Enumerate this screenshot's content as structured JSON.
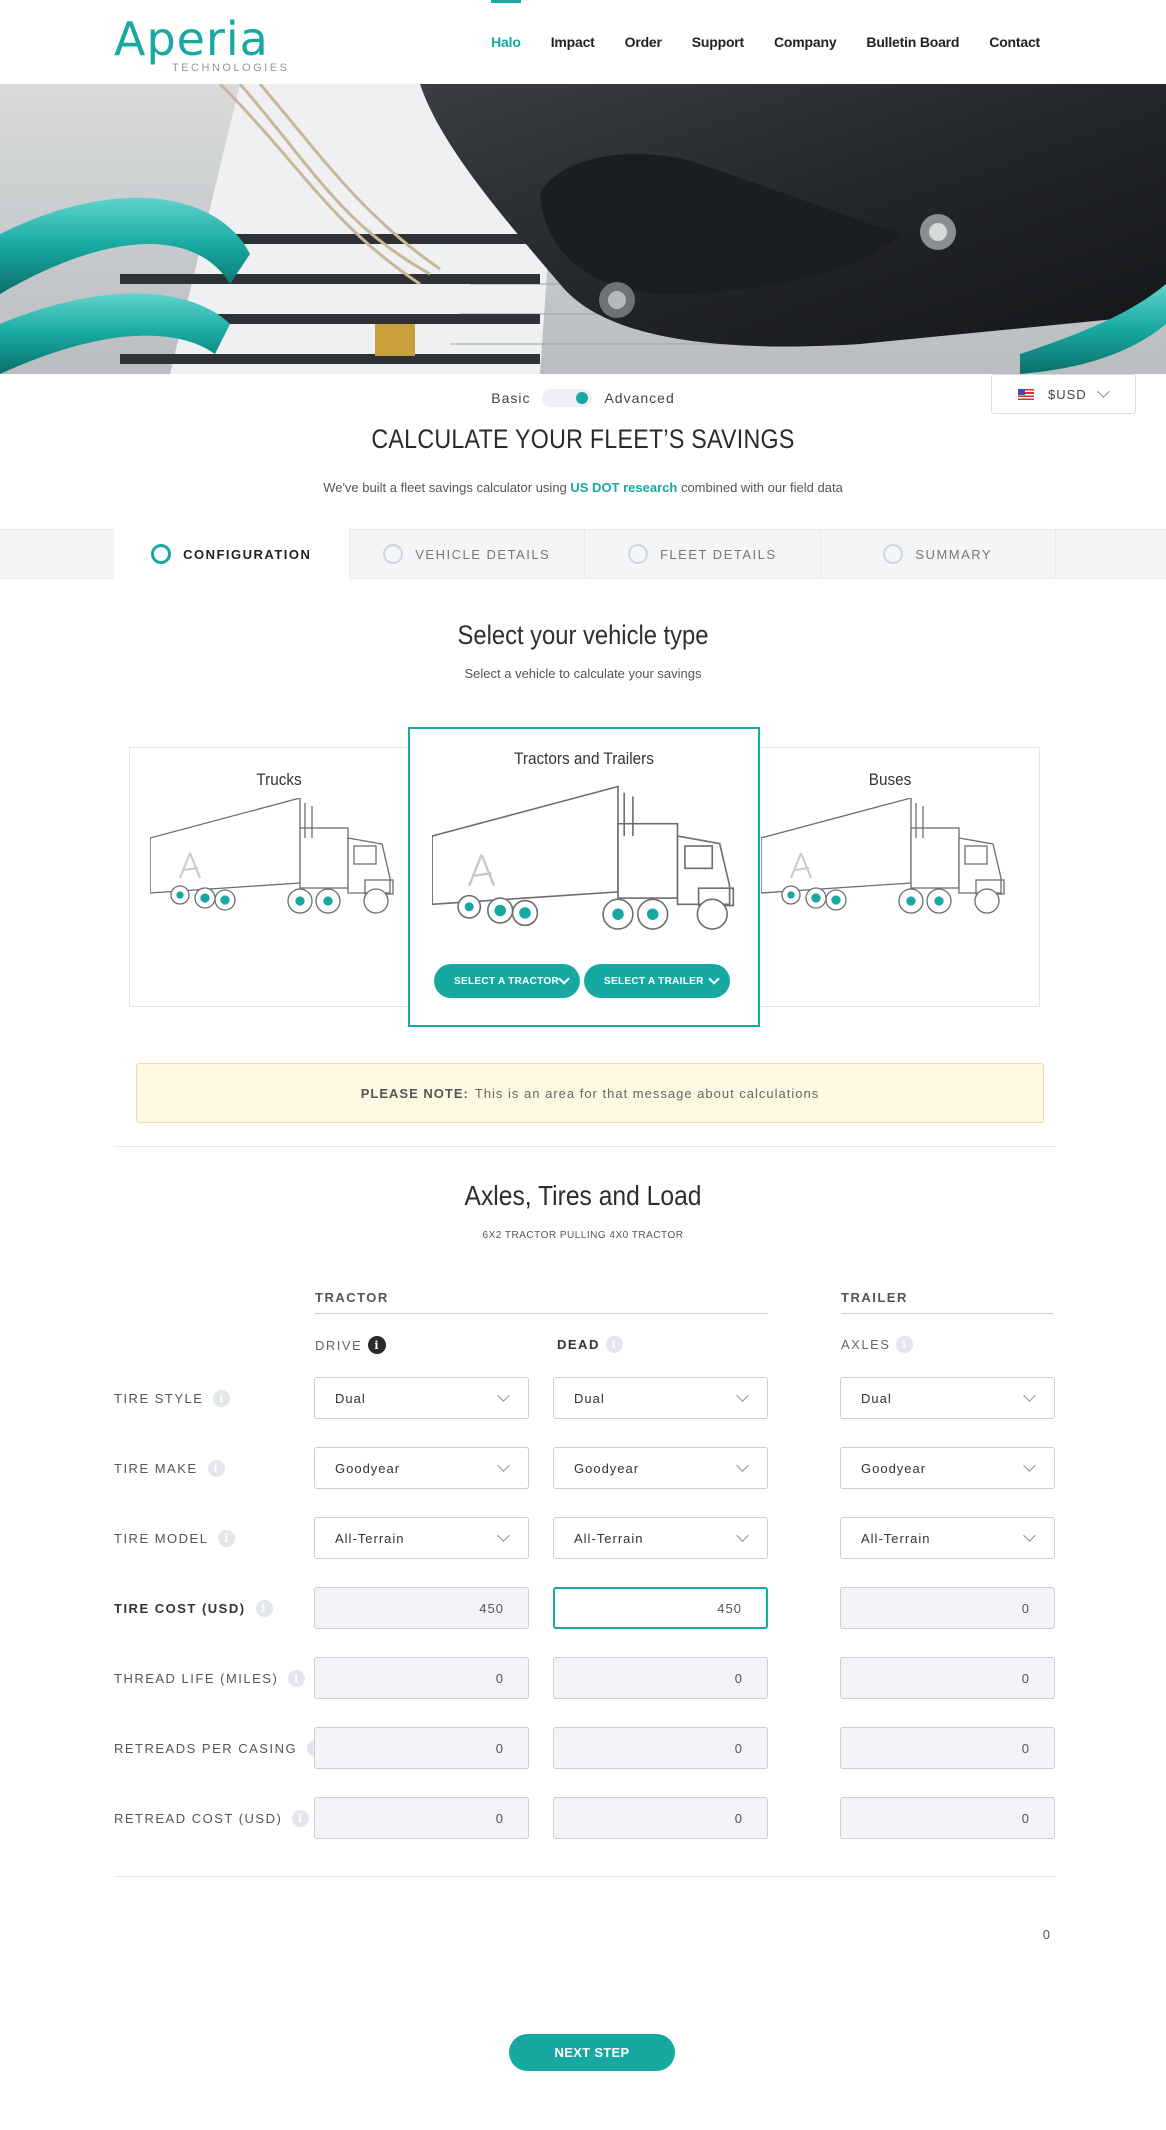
{
  "brand": {
    "name": "Aperia",
    "tagline": "TECHNOLOGIES",
    "accent": "#17a9a1"
  },
  "nav": {
    "items": [
      {
        "label": "Halo",
        "active": true
      },
      {
        "label": "Impact"
      },
      {
        "label": "Order"
      },
      {
        "label": "Support"
      },
      {
        "label": "Company"
      },
      {
        "label": "Bulletin Board"
      },
      {
        "label": "Contact"
      }
    ]
  },
  "mode": {
    "basic": "Basic",
    "advanced": "Advanced",
    "selected": "Advanced"
  },
  "currency": {
    "label": "$USD",
    "flag_icon": "us-flag-icon"
  },
  "header": {
    "title": "CALCULATE YOUR FLEET’S SAVINGS",
    "subtitle_pre": "We've built a fleet savings calculator using ",
    "subtitle_link": "US DOT research",
    "subtitle_post": " combined with our field data"
  },
  "steps": [
    {
      "label": "CONFIGURATION",
      "active": true
    },
    {
      "label": "VEHICLE DETAILS"
    },
    {
      "label": "FLEET DETAILS"
    },
    {
      "label": "SUMMARY"
    }
  ],
  "vehicle": {
    "title": "Select your vehicle type",
    "subtitle": "Select a vehicle to calculate your savings",
    "cards": [
      {
        "label": "Trucks"
      },
      {
        "label": "Tractors and Trailers",
        "selected": true
      },
      {
        "label": "Buses"
      }
    ],
    "select_tractor": "SELECT A TRACTOR",
    "select_trailer": "SELECT A TRAILER"
  },
  "note": {
    "prefix": "PLEASE NOTE:",
    "text": "This is an area for that message about calculations"
  },
  "axles": {
    "title": "Axles, Tires and Load",
    "subtitle": "6X2 TRACTOR PULLING 4X0 TRACTOR",
    "tractor_label": "TRACTOR",
    "trailer_label": "TRAILER",
    "drive_label": "DRIVE",
    "dead_label": "DEAD",
    "axles_label": "AXLES",
    "rows": [
      {
        "label": "TIRE STYLE",
        "drive": "Dual",
        "dead": "Dual",
        "trailer": "Dual"
      },
      {
        "label": "TIRE MAKE",
        "drive": "Goodyear",
        "dead": "Goodyear",
        "trailer": "Goodyear"
      },
      {
        "label": "TIRE MODEL",
        "drive": "All-Terrain",
        "dead": "All-Terrain",
        "trailer": "All-Terrain"
      },
      {
        "label": "TIRE COST (USD)",
        "drive": "450",
        "dead": "450",
        "trailer": "0"
      },
      {
        "label": "THREAD LIFE (MILES)",
        "drive": "0",
        "dead": "0",
        "trailer": "0"
      },
      {
        "label": "RETREADS PER CASING",
        "drive": "0",
        "dead": "0",
        "trailer": "0"
      },
      {
        "label": "RETREAD COST (USD)",
        "drive": "0",
        "dead": "0",
        "trailer": "0"
      }
    ],
    "total": "0"
  },
  "next_button": "NEXT STEP"
}
